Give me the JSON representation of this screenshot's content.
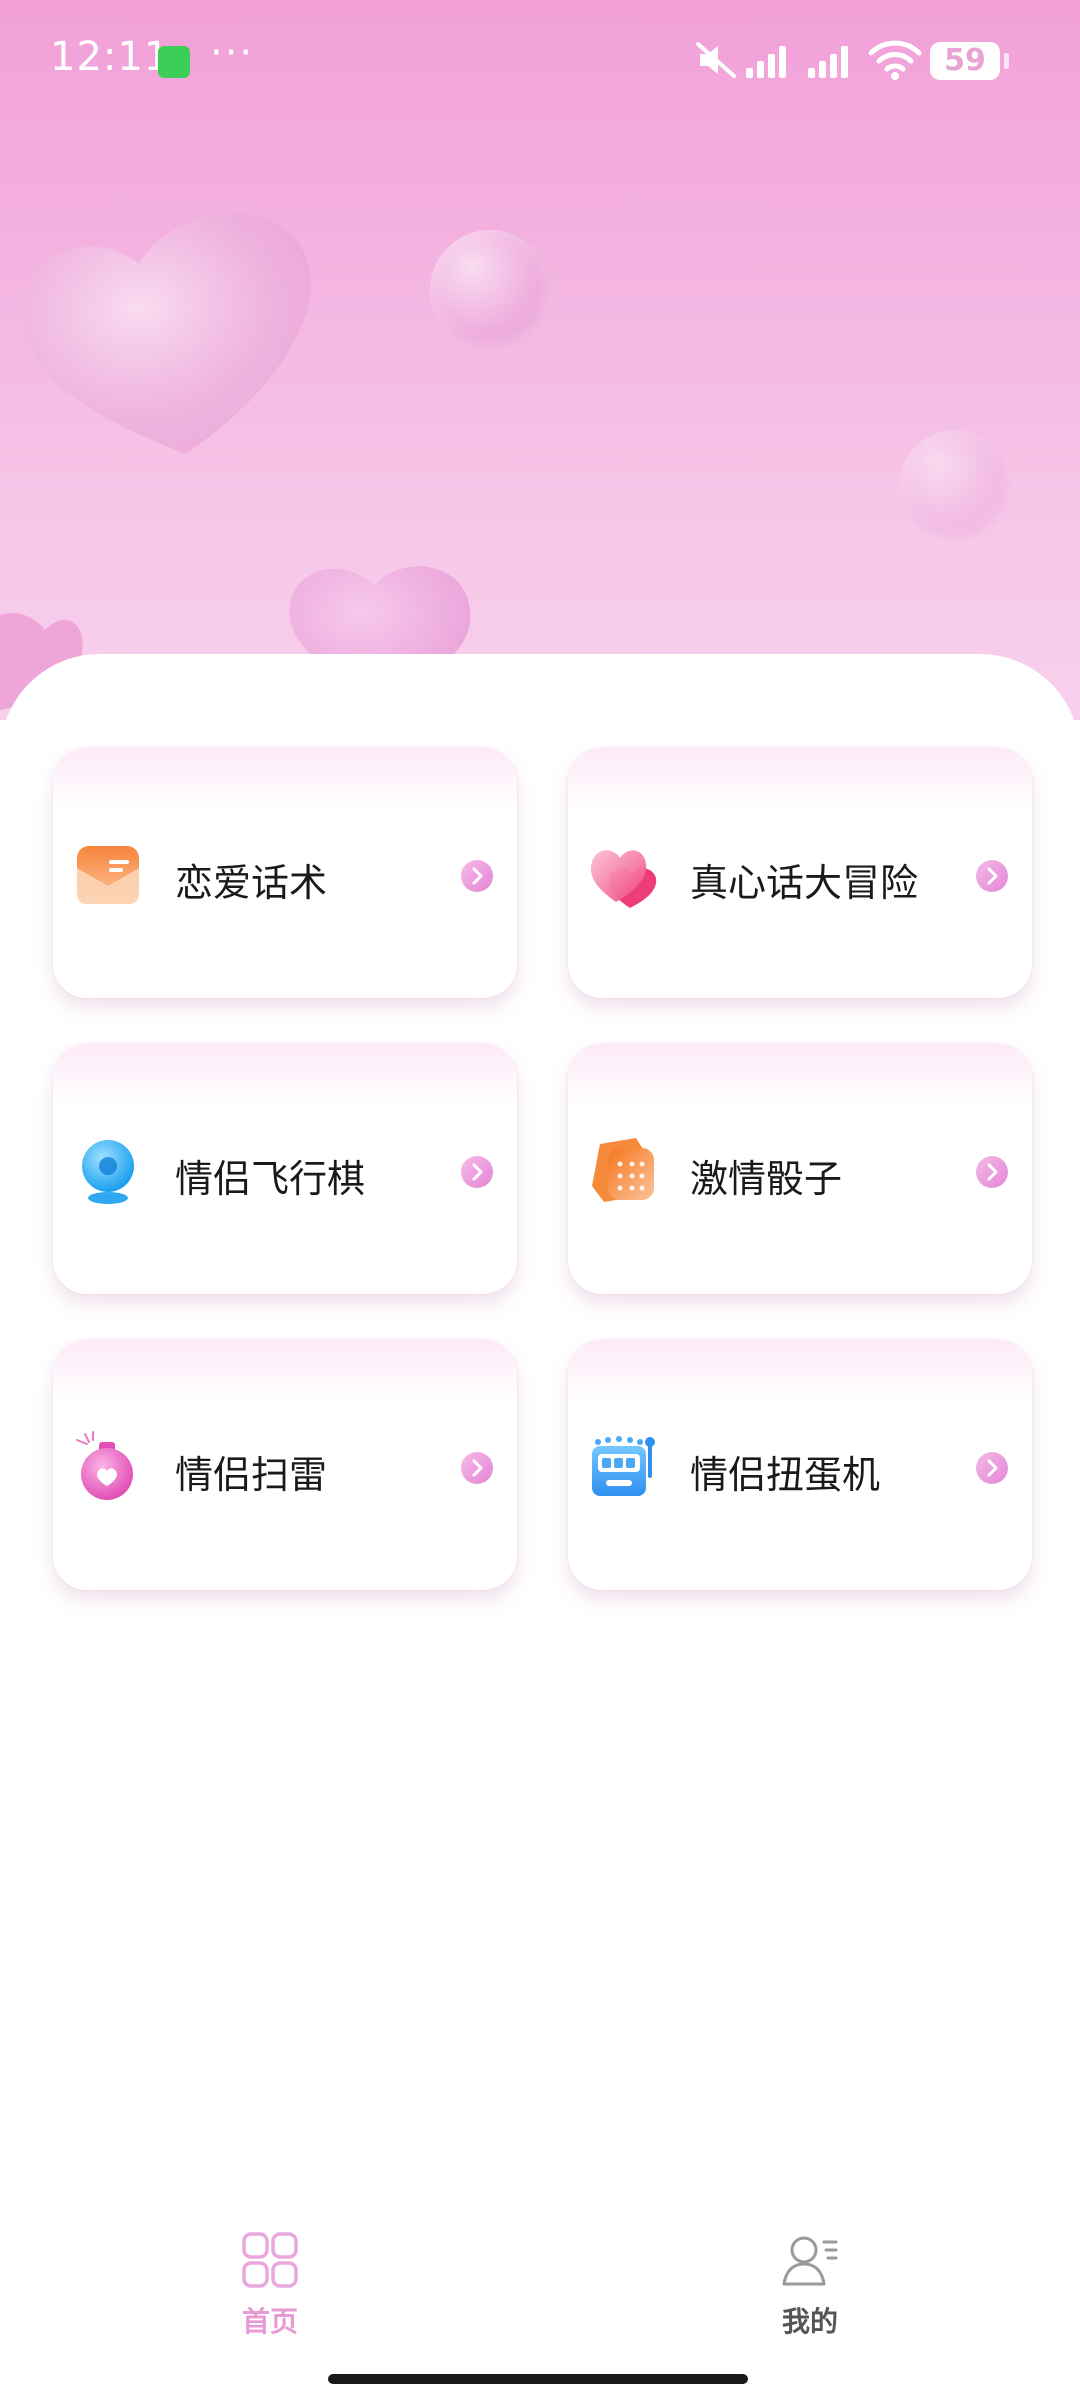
{
  "status_bar": {
    "time": "12:11",
    "more": "···",
    "battery": "59",
    "icons": [
      "notification-app-icon",
      "mute-icon",
      "signal-icon",
      "signal-icon",
      "wifi-icon",
      "battery-icon"
    ]
  },
  "cards": [
    {
      "label": "恋爱话术",
      "icon": "envelope-icon"
    },
    {
      "label": "真心话大冒险",
      "icon": "heart-icon"
    },
    {
      "label": "情侣飞行棋",
      "icon": "chess-piece-icon"
    },
    {
      "label": "激情骰子",
      "icon": "dice-icon"
    },
    {
      "label": "情侣扫雷",
      "icon": "bomb-icon"
    },
    {
      "label": "情侣扭蛋机",
      "icon": "slot-machine-icon"
    }
  ],
  "tabbar": {
    "home_label": "首页",
    "mine_label": "我的",
    "active_color": "#e89ad6",
    "inactive_color": "#555555"
  },
  "colors": {
    "hero_gradient_top": "#f1a0d8",
    "hero_gradient_bottom": "#f8d0ec",
    "arrow": "#e486d6"
  }
}
